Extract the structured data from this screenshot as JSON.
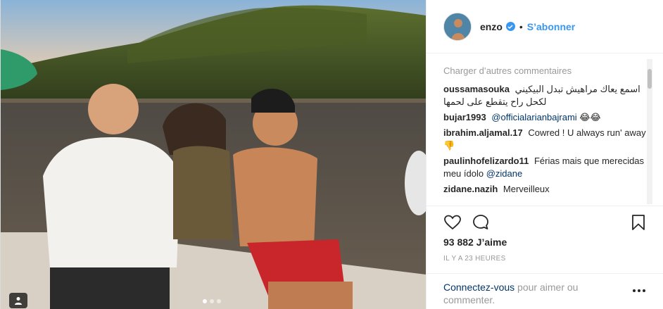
{
  "post": {
    "username": "enzo",
    "separator": "•",
    "follow_label": "S’abonner",
    "load_more_label": "Charger d’autres commentaires",
    "comments": [
      {
        "user": "oussamasouka",
        "text": "اسمع يعاك مراهيش تبدل البيكيني لكحل راح يتقطع على لحمها"
      },
      {
        "user": "bujar1993",
        "mention": "@officialarianbajrami",
        "text": "😂😂"
      },
      {
        "user": "ibrahim.aljamal.17",
        "text": "Cowred ! U always run' away 👎"
      },
      {
        "user": "paulinhofelizardo11",
        "text": "Férias mais que merecidas meu ídolo",
        "mention": "@zidane"
      },
      {
        "user": "zidane.nazih",
        "text": "Merveilleux"
      }
    ],
    "likes": "93 882 J’aime",
    "time": "IL Y A 23 HEURES",
    "login_link": "Connectez-vous",
    "login_text": " pour aimer ou commenter.",
    "carousel": {
      "count": 3,
      "active": 1
    }
  },
  "icons": {
    "verified": "verified-badge-icon",
    "like": "heart-icon",
    "comment": "comment-bubble-icon",
    "save": "bookmark-icon",
    "more": "more-options-icon",
    "tag": "person-tag-icon"
  },
  "colors": {
    "accent": "#3897f0",
    "link": "#003569",
    "muted": "#999999",
    "text": "#262626",
    "border": "#efefef"
  }
}
